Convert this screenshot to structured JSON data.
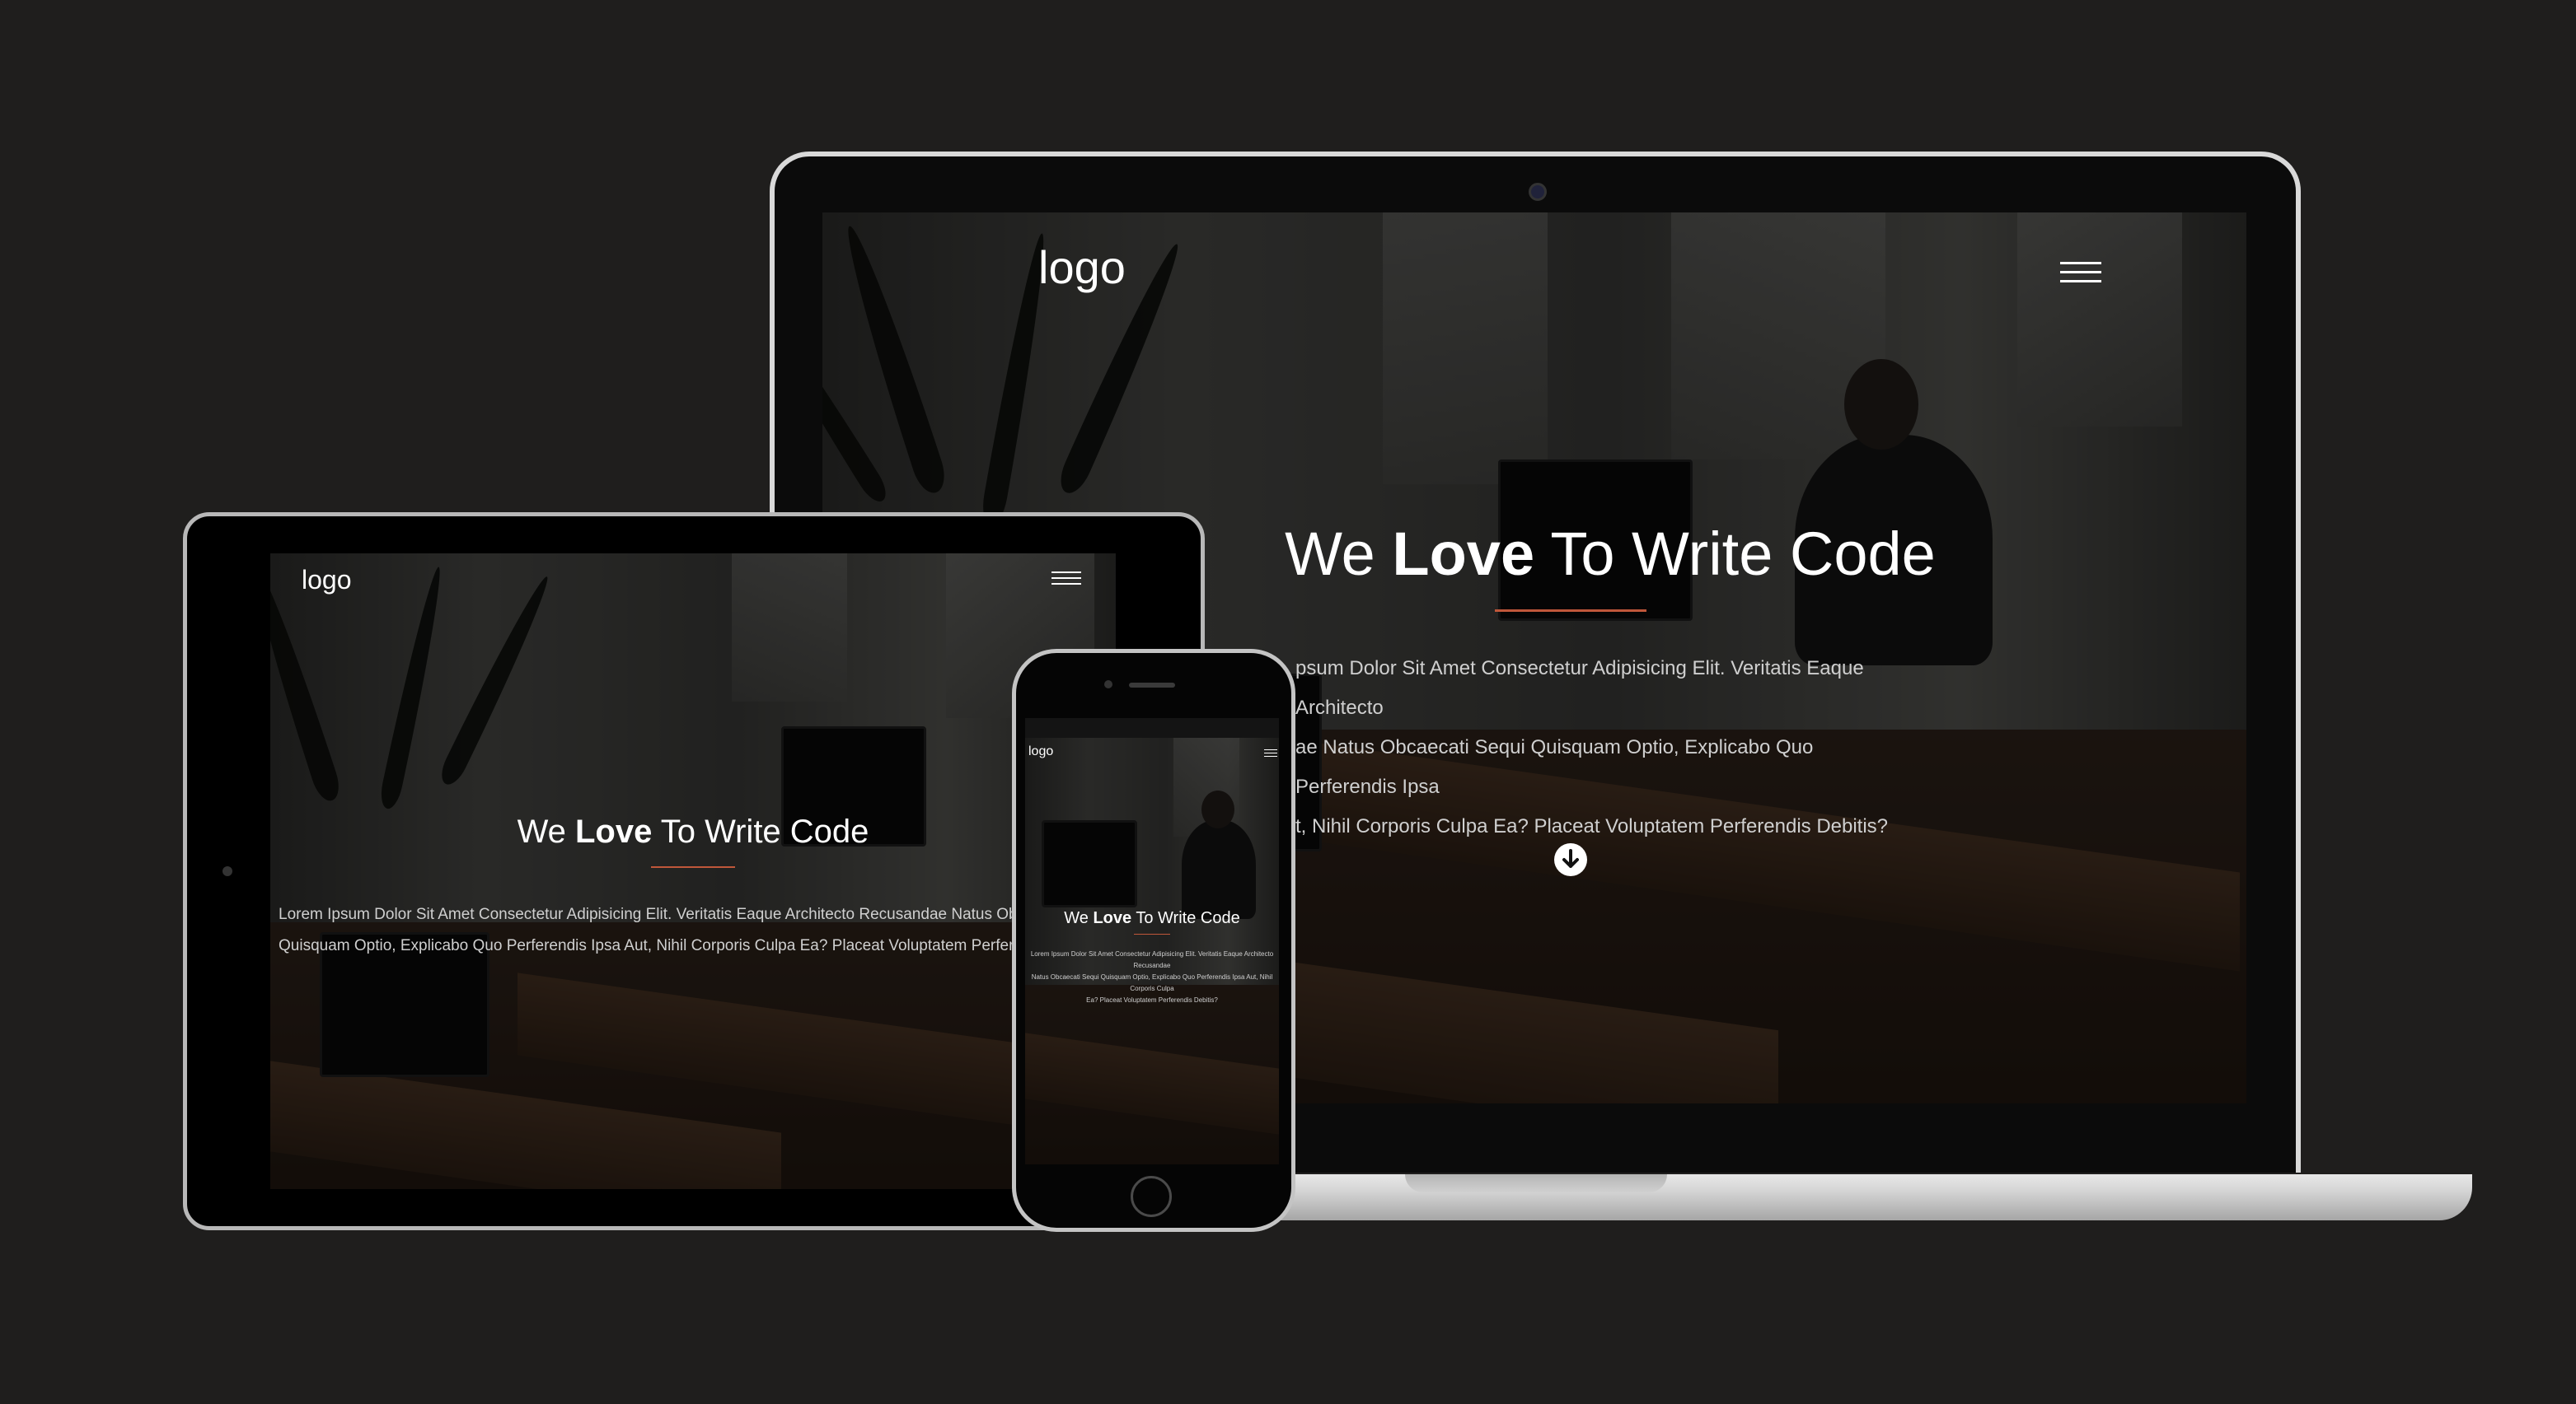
{
  "page": {
    "background": "#1f1e1d"
  },
  "site": {
    "logo": "logo",
    "headline_pre": "We",
    "headline_bold": "Love",
    "headline_post": "To Write Code",
    "accent": "#c0573a",
    "lead_laptop": [
      "psum Dolor Sit Amet Consectetur Adipisicing Elit. Veritatis Eaque Architecto",
      "ae Natus Obcaecati Sequi Quisquam Optio, Explicabo Quo Perferendis Ipsa",
      "t, Nihil Corporis Culpa Ea? Placeat Voluptatem Perferendis Debitis?"
    ],
    "lead_tablet": [
      "Lorem Ipsum Dolor Sit Amet Consectetur Adipisicing Elit. Veritatis Eaque Architecto Recusandae Natus Ob",
      "Quisquam Optio, Explicabo Quo Perferendis Ipsa Aut, Nihil Corporis Culpa Ea? Placeat Voluptatem Perfer"
    ],
    "lead_phone": [
      "Lorem Ipsum Dolor Sit Amet Consectetur Adipisicing Elit. Veritatis Eaque Architecto Recusandae",
      "Natus Obcaecati Sequi Quisquam Optio, Explicabo Quo Perferendis Ipsa Aut, Nihil Corporis Culpa",
      "Ea? Placeat Voluptatem Perferendis Debitis?"
    ],
    "menu_icon": "hamburger-menu-icon",
    "scroll_icon": "arrow-down-circle-icon"
  }
}
